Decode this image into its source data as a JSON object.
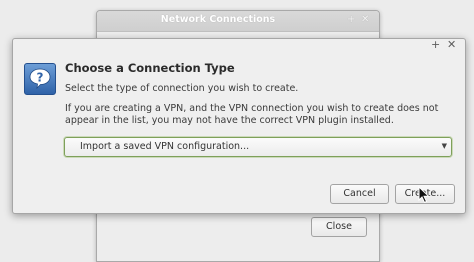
{
  "background_window": {
    "title": "Network Connections",
    "minimize_glyph": "+",
    "close_glyph": "✕",
    "close_label": "Close"
  },
  "dialog": {
    "maximize_glyph": "+",
    "close_glyph": "✕",
    "icon": "question-icon",
    "heading": "Choose a Connection Type",
    "subtitle": "Select the type of connection you wish to create.",
    "info": "If you are creating a VPN, and the VPN connection you wish to create does not appear in the list, you may not have the correct VPN plugin installed.",
    "vpn_select": {
      "selected": "Import a saved VPN configuration..."
    },
    "cancel_label": "Cancel",
    "create_label": "Create..."
  },
  "colors": {
    "focus_border": "#7ea05a",
    "icon_blue": "#2f62a8"
  }
}
